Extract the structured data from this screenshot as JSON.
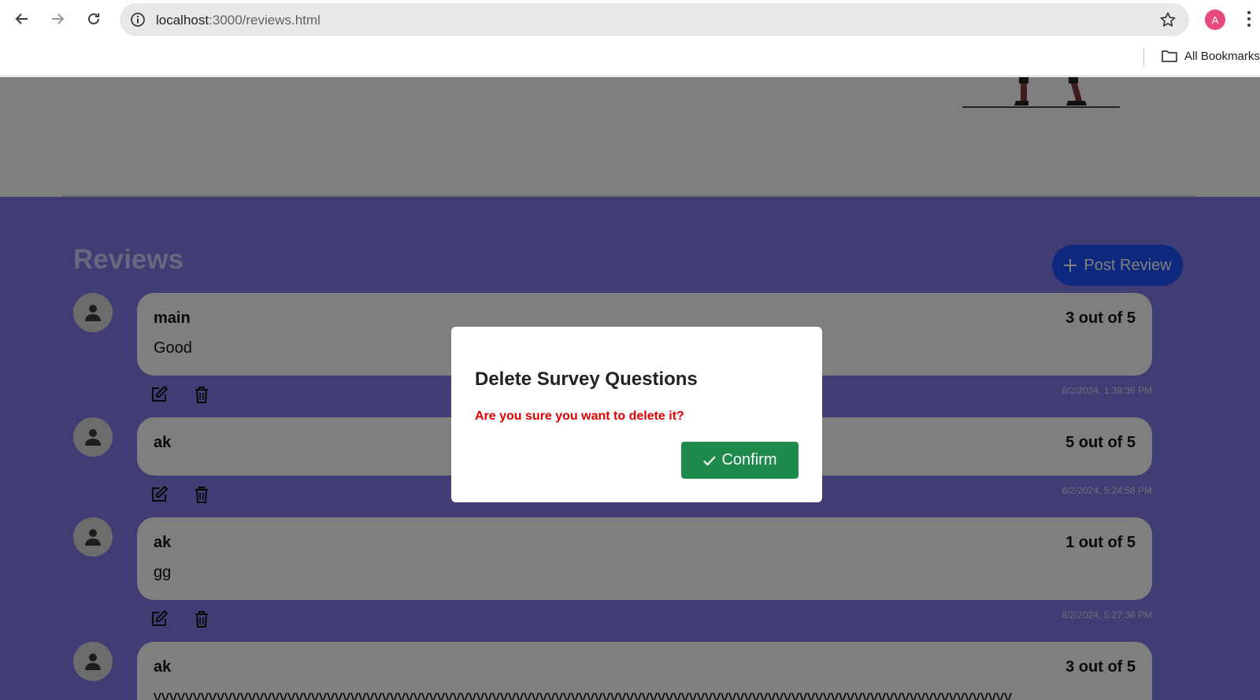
{
  "browser": {
    "url_host": "localhost",
    "url_path": ":3000/reviews.html",
    "profile_initial": "A",
    "bookmarks_label": "All Bookmarks"
  },
  "reviews_section": {
    "title": "Reviews",
    "post_button_label": "Post Review",
    "items": [
      {
        "user": "main",
        "rating": "3 out of 5",
        "text": "Good",
        "date": "8/2/2024, 1:39:36 PM"
      },
      {
        "user": "ak",
        "rating": "5 out of 5",
        "text": "",
        "date": "8/2/2024, 5:24:58 PM"
      },
      {
        "user": "ak",
        "rating": "1 out of 5",
        "text": "gg",
        "date": "8/2/2024, 5:27:36 PM"
      },
      {
        "user": "ak",
        "rating": "3 out of 5",
        "text": "vvvvvvvvvvvvvvvvvvvvvvvvvvvvvvvvvvvvvvvvvvvvvvvvvvvvvvvvvvvvvvvvvvvvvvvvvvvvvvvvvvvvvvvvvvvvvvvvvvvvvvvvvvvvv",
        "date": ""
      }
    ]
  },
  "modal": {
    "title": "Delete Survey Questions",
    "message": "Are you sure you want to delete it?",
    "confirm_label": "Confirm"
  },
  "icons": {
    "back": "arrow-left-icon",
    "forward": "arrow-right-icon",
    "reload": "reload-icon",
    "site_info": "info-icon",
    "bookmark": "star-icon",
    "bookmarks_folder": "folder-icon",
    "user": "person-icon",
    "edit": "edit-icon",
    "delete": "trash-icon",
    "confirm": "check-icon",
    "add": "plus-icon"
  }
}
